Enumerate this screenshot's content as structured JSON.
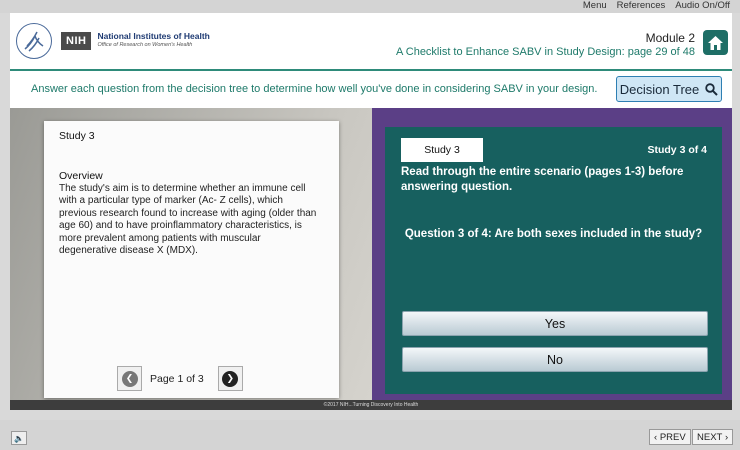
{
  "top_menu": {
    "menu": "Menu",
    "references": "References",
    "audio": "Audio On/Off"
  },
  "header": {
    "org_abbr": "NIH",
    "org_name": "National Institutes of Health",
    "office": "Office of Research on Women's Health",
    "module_title": "Module 2",
    "module_subtitle": "A Checklist to Enhance SABV in Study Design: page 29 of 48"
  },
  "instruction": {
    "text": "Answer each question from the decision tree to determine how well you've done in considering SABV in your design.",
    "decision_tree_label": "Decision Tree"
  },
  "study_card": {
    "title": "Study 3",
    "heading": "Overview",
    "body": "The study's aim is to determine whether an immune cell with a particular type of marker (Ac- Z cells), which previous research found to increase with aging (older than age 60) and to have proinflammatory characteristics, is more prevalent among patients with muscular degenerative disease X (MDX).",
    "page_label": "Page 1 of 3"
  },
  "question_panel": {
    "tab_label": "Study 3",
    "study_count": "Study 3 of 4",
    "note": "Read through the entire scenario (pages 1-3) before answering question.",
    "question": "Question 3 of 4: Are both sexes included in the study?",
    "answers": [
      "Yes",
      "No"
    ]
  },
  "copyright": "©2017 NIH...Turning Discovery Into Health",
  "footer": {
    "prev": "PREV",
    "next": "NEXT"
  },
  "colors": {
    "teal": "#17605f",
    "purple": "#5b3f86",
    "accent": "#1e7a6a"
  }
}
